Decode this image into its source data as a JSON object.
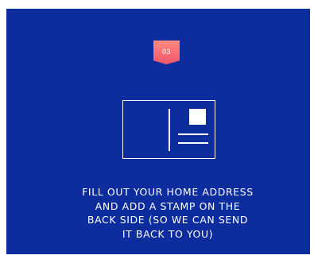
{
  "step": {
    "number": "03"
  },
  "postcard": {
    "icon": "postcard-icon"
  },
  "instructions": {
    "lines": [
      "FILL OUT YOUR HOME ADDRESS",
      "AND ADD A STAMP ON THE",
      "BACK SIDE (SO WE CAN SEND",
      "IT BACK TO YOU)"
    ]
  },
  "colors": {
    "card_background": "#0d2d9f",
    "badge_top": "#ff8a7e",
    "badge_bottom": "#f2566a",
    "foreground": "#ffffff"
  }
}
